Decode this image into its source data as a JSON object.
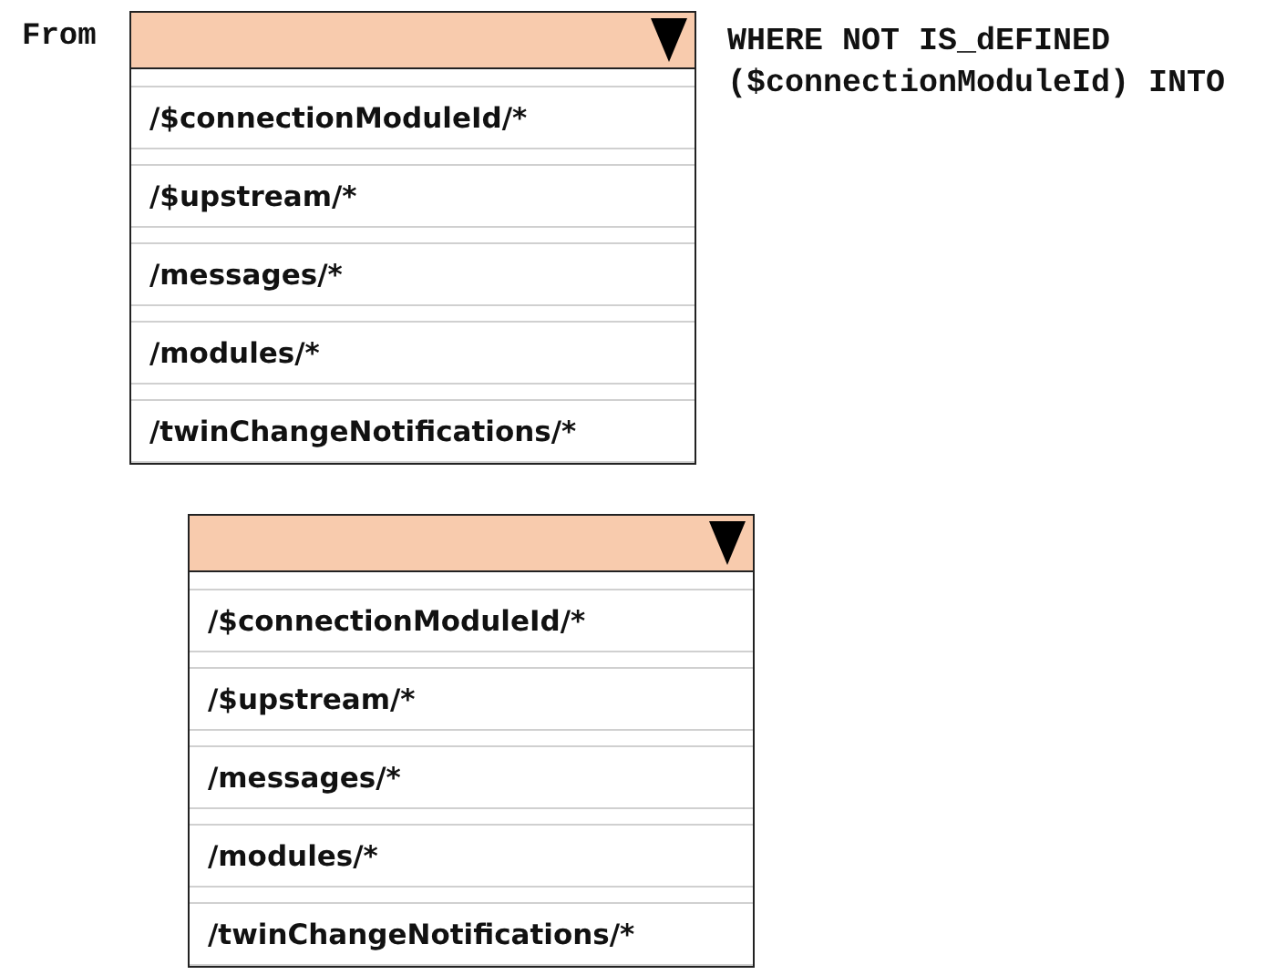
{
  "from_label": "From",
  "dropdowns": [
    {
      "expanded": true,
      "options": [
        "/$connectionModuleId/*",
        "/$upstream/*",
        "/messages/*",
        "/modules/*",
        "/twinChangeNotifications/*"
      ]
    },
    {
      "expanded": true,
      "options": [
        "/$connectionModuleId/*",
        "/$upstream/*",
        "/messages/*",
        "/modules/*",
        "/twinChangeNotifications/*"
      ]
    }
  ],
  "clause": [
    "WHERE NOT IS_dEFINED",
    "($connectionModuleId) INTO"
  ]
}
